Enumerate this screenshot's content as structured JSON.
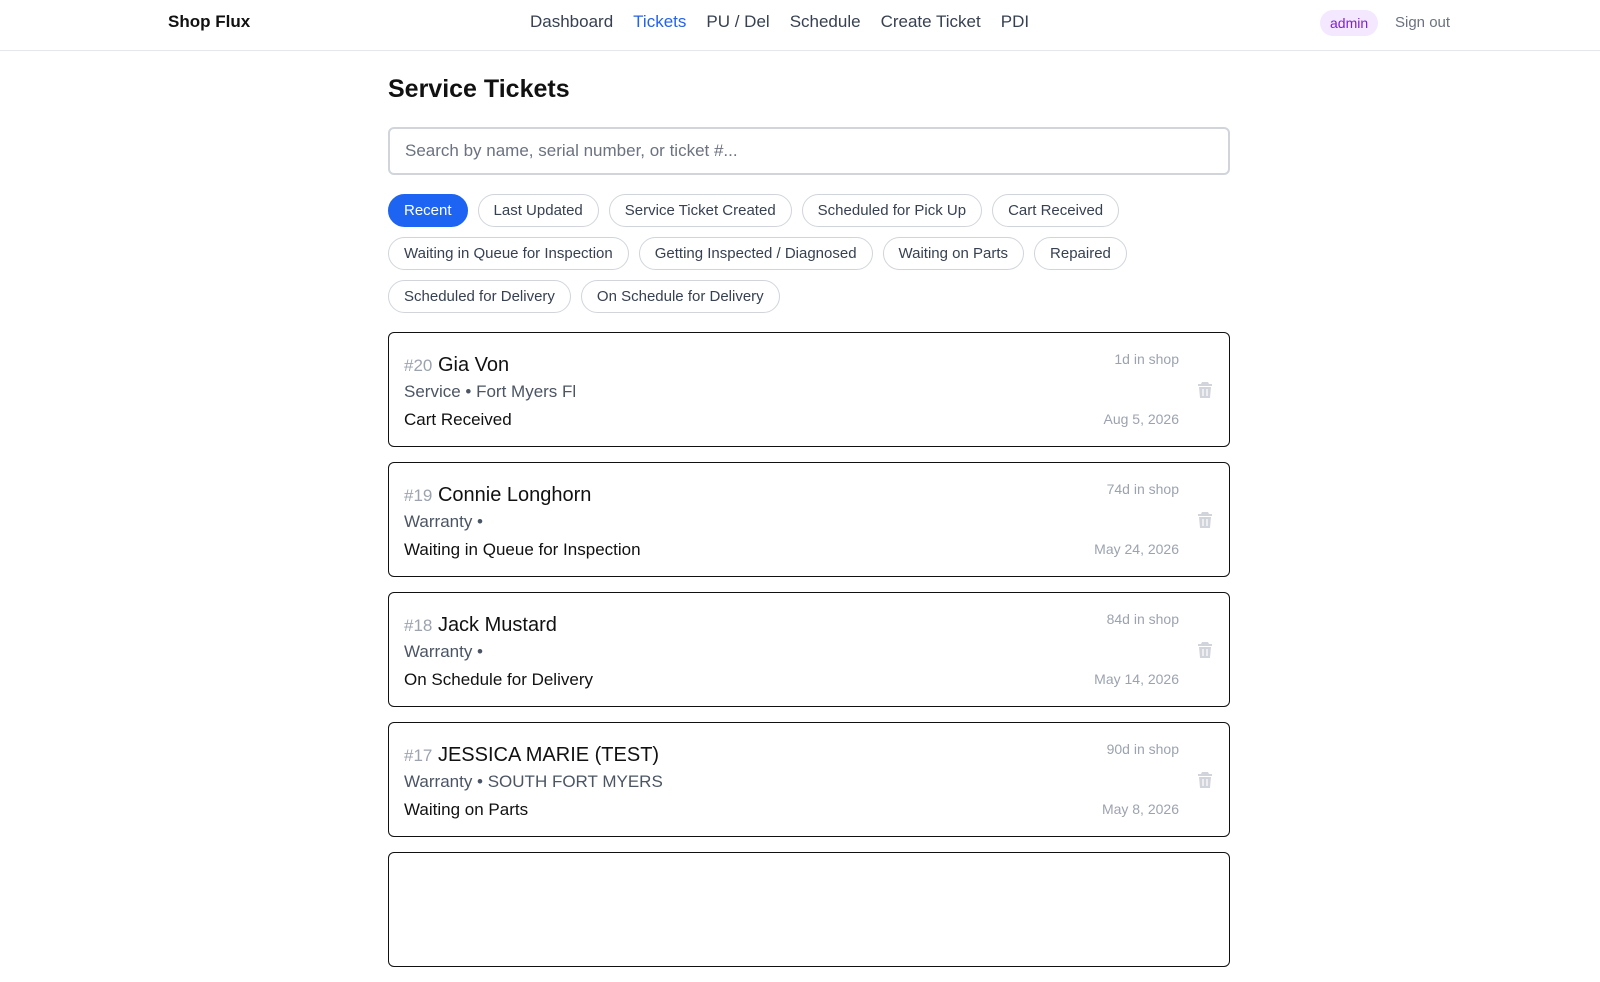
{
  "header": {
    "brand": "Shop Flux",
    "nav": [
      {
        "label": "Dashboard",
        "active": false
      },
      {
        "label": "Tickets",
        "active": true
      },
      {
        "label": "PU / Del",
        "active": false
      },
      {
        "label": "Schedule",
        "active": false
      },
      {
        "label": "Create Ticket",
        "active": false
      },
      {
        "label": "PDI",
        "active": false
      }
    ],
    "role_badge": "admin",
    "sign_out": "Sign out"
  },
  "page": {
    "title": "Service Tickets",
    "search_placeholder": "Search by name, serial number, or ticket #..."
  },
  "filters": [
    {
      "label": "Recent",
      "active": true
    },
    {
      "label": "Last Updated",
      "active": false
    },
    {
      "label": "Service Ticket Created",
      "active": false
    },
    {
      "label": "Scheduled for Pick Up",
      "active": false
    },
    {
      "label": "Cart Received",
      "active": false
    },
    {
      "label": "Waiting in Queue for Inspection",
      "active": false
    },
    {
      "label": "Getting Inspected / Diagnosed",
      "active": false
    },
    {
      "label": "Waiting on Parts",
      "active": false
    },
    {
      "label": "Repaired",
      "active": false
    },
    {
      "label": "Scheduled for Delivery",
      "active": false
    },
    {
      "label": "On Schedule for Delivery",
      "active": false
    }
  ],
  "tickets": [
    {
      "number": "#20",
      "name": "Gia Von",
      "subtitle": "Service • Fort Myers Fl",
      "status": "Cart Received",
      "age": "1d in shop",
      "date": "Aug 5, 2026"
    },
    {
      "number": "#19",
      "name": "Connie Longhorn",
      "subtitle": "Warranty •",
      "status": "Waiting in Queue for Inspection",
      "age": "74d in shop",
      "date": "May 24, 2026"
    },
    {
      "number": "#18",
      "name": "Jack Mustard",
      "subtitle": "Warranty •",
      "status": "On Schedule for Delivery",
      "age": "84d in shop",
      "date": "May 14, 2026"
    },
    {
      "number": "#17",
      "name": "JESSICA MARIE (TEST)",
      "subtitle": "Warranty • SOUTH FORT MYERS",
      "status": "Waiting on Parts",
      "age": "90d in shop",
      "date": "May 8, 2026"
    },
    {
      "number": "",
      "name": "",
      "subtitle": "",
      "status": "",
      "age": "",
      "date": ""
    }
  ],
  "colors": {
    "accent": "#1d64f2",
    "link_active": "#2563eb",
    "badge_bg": "#f3e8ff",
    "badge_text": "#7e22ce"
  },
  "icons": {
    "delete": "trash-icon"
  }
}
